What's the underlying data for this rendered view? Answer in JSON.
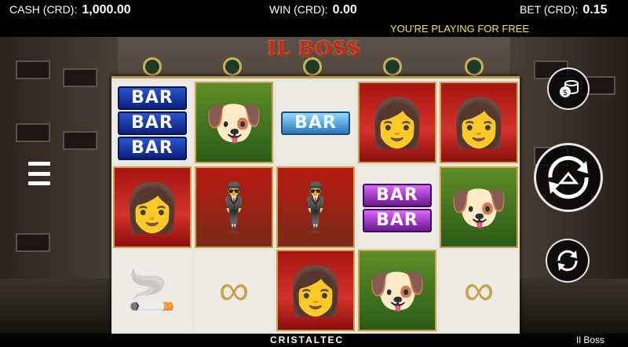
{
  "header": {
    "cash_label": "CASH (CRD):",
    "cash_value": "1,000.00",
    "win_label": "WIN (CRD):",
    "win_value": "0.00",
    "bet_label": "BET (CRD):",
    "bet_value": "0.15",
    "free_play_message": "YOU'RE PLAYING FOR FREE"
  },
  "logo": {
    "text": "IL BOSS"
  },
  "reels": [
    [
      "bar-triple-blue",
      "woman",
      "cigar"
    ],
    [
      "bulldog",
      "mobster",
      "brass-knuckles"
    ],
    [
      "bar-single-cyan",
      "mobster",
      "woman"
    ],
    [
      "woman",
      "bar-double-purple",
      "bulldog"
    ],
    [
      "woman",
      "bulldog",
      "brass-knuckles"
    ]
  ],
  "symbol_text": {
    "bar": "BAR"
  },
  "footer": {
    "brand": "CRISTALTEC",
    "game_name": "Il Boss"
  },
  "colors": {
    "free_message": "#f2e14a",
    "logo_red": "#c9261c",
    "frame_gold": "#c9a34a"
  },
  "icons": {
    "menu": "hamburger-icon",
    "coins": "coin-stack-icon",
    "spin": "spin-arrow-icon",
    "autoplay": "autoplay-icon"
  }
}
